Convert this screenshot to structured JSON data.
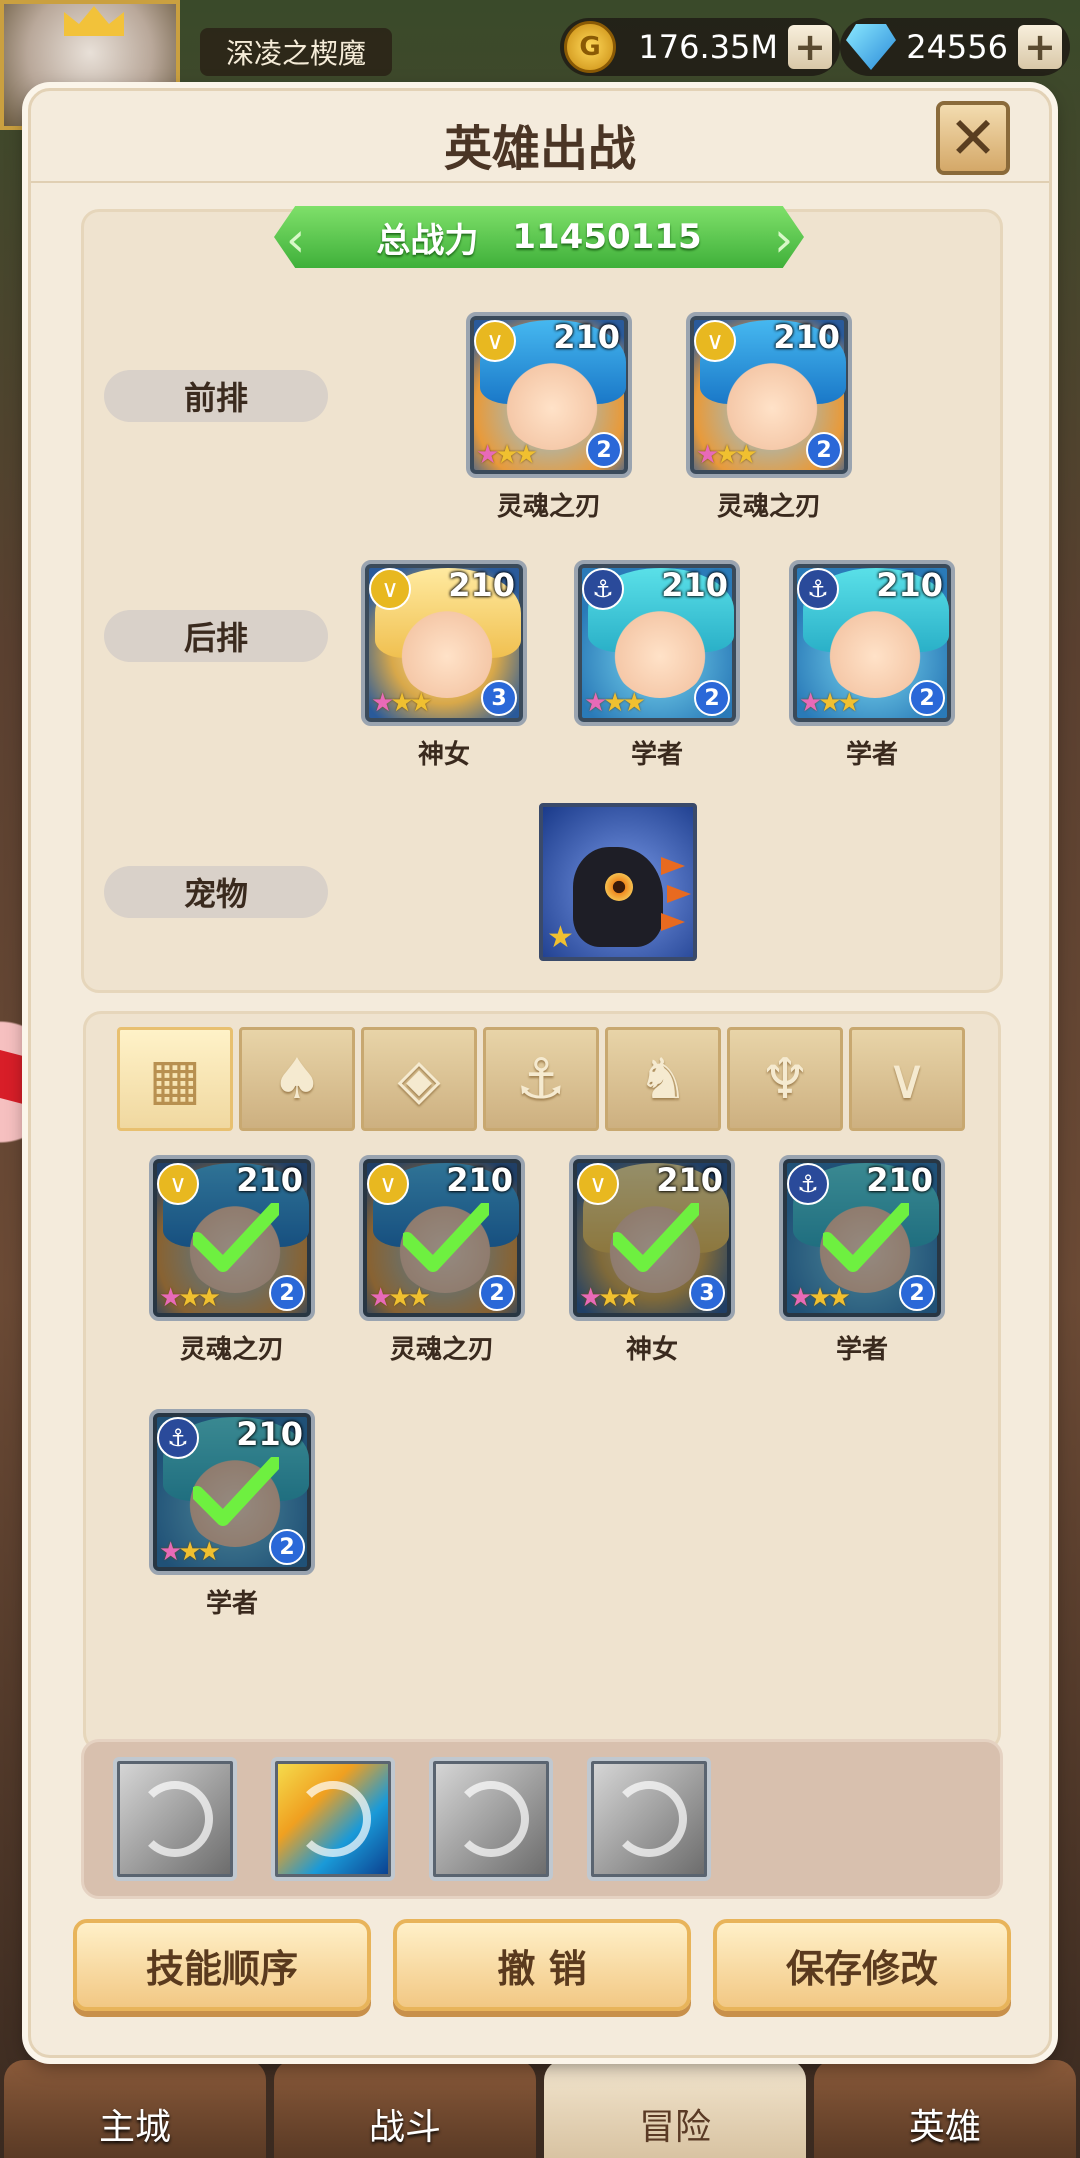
{
  "topbar": {
    "player_name": "深凌之楔魔",
    "gold": "176.35M",
    "gems": "24556",
    "plus": "+"
  },
  "dialog": {
    "title": "英雄出战",
    "close": "✕"
  },
  "power": {
    "label": "总战力",
    "value": "11450115"
  },
  "rows": {
    "front": "前排",
    "back": "后排",
    "pet": "宠物"
  },
  "front_heroes": [
    {
      "name": "灵魂之刃",
      "level": "210",
      "rank": "2"
    },
    {
      "name": "灵魂之刃",
      "level": "210",
      "rank": "2"
    }
  ],
  "back_heroes": [
    {
      "name": "神女",
      "level": "210",
      "rank": "3"
    },
    {
      "name": "学者",
      "level": "210",
      "rank": "2"
    },
    {
      "name": "学者",
      "level": "210",
      "rank": "2"
    }
  ],
  "filters": [
    {
      "icon": "grid-icon",
      "glyph": "▦"
    },
    {
      "icon": "warrior-class-icon",
      "glyph": "♠"
    },
    {
      "icon": "support-class-icon",
      "glyph": "◈"
    },
    {
      "icon": "anchor-class-icon",
      "glyph": "⚓"
    },
    {
      "icon": "beast-class-icon",
      "glyph": "♞"
    },
    {
      "icon": "assassin-class-icon",
      "glyph": "♆"
    },
    {
      "icon": "tank-class-icon",
      "glyph": "∨"
    }
  ],
  "roster": [
    {
      "name": "灵魂之刃",
      "level": "210",
      "rank": "2",
      "selected": true
    },
    {
      "name": "灵魂之刃",
      "level": "210",
      "rank": "2",
      "selected": true
    },
    {
      "name": "神女",
      "level": "210",
      "rank": "3",
      "selected": true
    },
    {
      "name": "学者",
      "level": "210",
      "rank": "2",
      "selected": true
    },
    {
      "name": "学者",
      "level": "210",
      "rank": "2",
      "selected": true
    }
  ],
  "buttons": {
    "skill_order": "技能顺序",
    "revoke": "撤 销",
    "save": "保存修改"
  },
  "bottom_nav": [
    {
      "label": "主城",
      "active": false
    },
    {
      "label": "战斗",
      "active": false
    },
    {
      "label": "冒险",
      "active": true
    },
    {
      "label": "英雄",
      "active": false
    }
  ],
  "colors": {
    "power_banner": "#4fc048",
    "dialog_bg": "#f4ebdc",
    "button_bg": "#f2c884",
    "rank_badge": "#2a68d8"
  }
}
